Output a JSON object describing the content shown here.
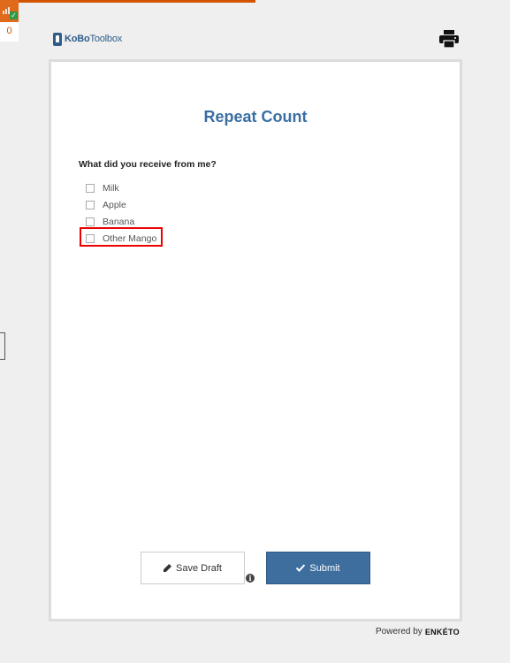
{
  "status": {
    "queue_count": "0"
  },
  "header": {
    "logo_bold": "KoBo",
    "logo_light": "Toolbox"
  },
  "form": {
    "title": "Repeat Count",
    "question": {
      "label": "What did you receive from me?",
      "options": [
        {
          "label": "Milk",
          "checked": false
        },
        {
          "label": "Apple",
          "checked": false
        },
        {
          "label": "Banana",
          "checked": false
        },
        {
          "label": "Other Mango",
          "checked": false
        }
      ]
    }
  },
  "actions": {
    "save_draft_label": "Save Draft",
    "submit_label": "Submit"
  },
  "footer": {
    "powered_label": "Powered by",
    "brand": "ENKÉTO"
  },
  "colors": {
    "accent": "#3d6e9e",
    "title": "#3a6fa3",
    "highlight": "#e00000",
    "progress": "#d35400"
  },
  "icons": [
    "signal-icon",
    "check-icon",
    "print-icon",
    "pencil-icon",
    "info-icon",
    "check-icon"
  ]
}
